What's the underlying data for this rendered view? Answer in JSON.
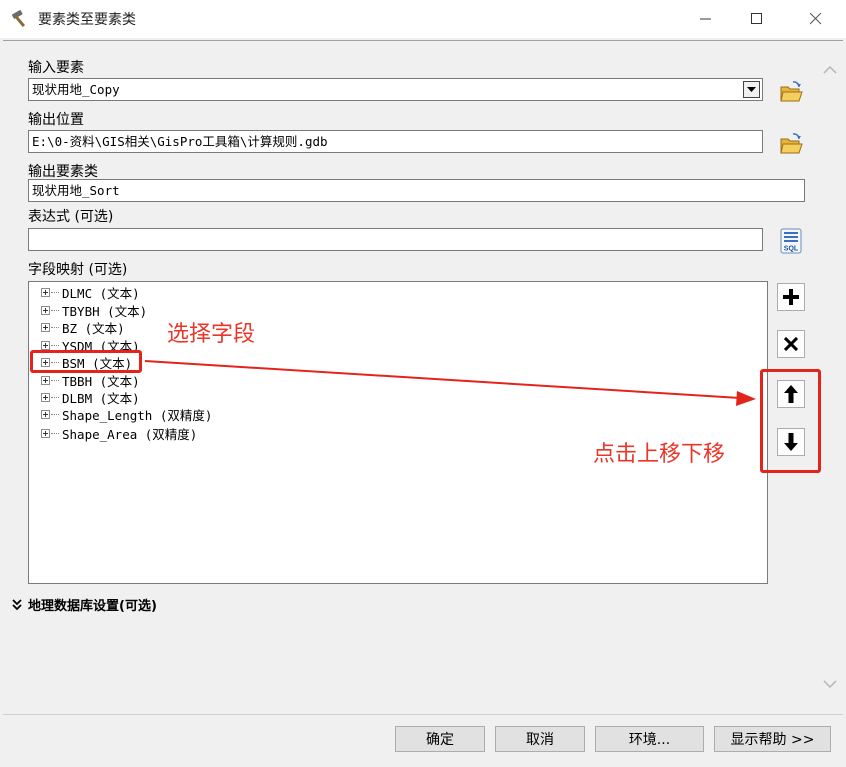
{
  "window": {
    "title": "要素类至要素类",
    "app_icon": "hammer-icon"
  },
  "form": {
    "input_features": {
      "label": "输入要素",
      "value": "现状用地_Copy"
    },
    "output_location": {
      "label": "输出位置",
      "value": "E:\\0-资料\\GIS相关\\GisPro工具箱\\计算规则.gdb"
    },
    "output_feature_class": {
      "label": "输出要素类",
      "value": "现状用地_Sort"
    },
    "expression": {
      "label": "表达式 (可选)",
      "value": ""
    },
    "field_map": {
      "label": "字段映射 (可选)",
      "fields": [
        "DLMC (文本)",
        "TBYBH (文本)",
        "BZ (文本)",
        "YSDM (文本)",
        "BSM (文本)",
        "TBBH (文本)",
        "DLBM (文本)",
        "Shape_Length (双精度)",
        "Shape_Area (双精度)"
      ]
    },
    "geodatabase_settings": "地理数据库设置(可选)",
    "sql_icon_text": "SQL"
  },
  "annotations": {
    "select_field": "选择字段",
    "move_up_down": "点击上移下移",
    "color": "#e3241b"
  },
  "buttons": {
    "ok": "确定",
    "cancel": "取消",
    "environments": "环境...",
    "show_help": "显示帮助 >>"
  }
}
